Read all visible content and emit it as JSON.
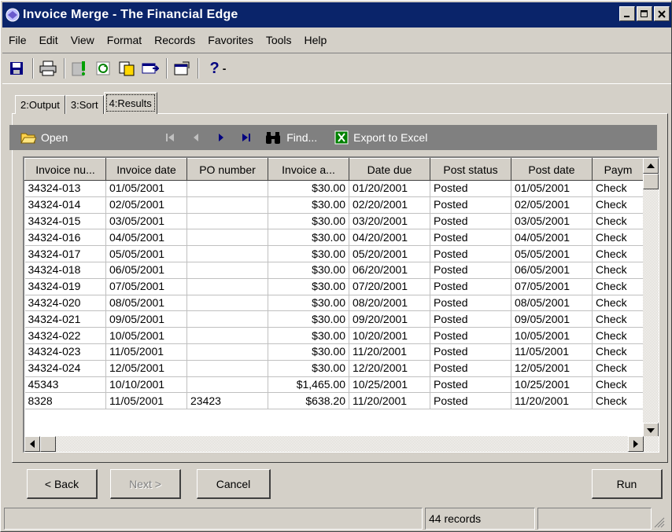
{
  "window": {
    "title": "Invoice Merge - The Financial Edge"
  },
  "menu": [
    {
      "label": "File"
    },
    {
      "label": "Edit"
    },
    {
      "label": "View"
    },
    {
      "label": "Format"
    },
    {
      "label": "Records"
    },
    {
      "label": "Favorites"
    },
    {
      "label": "Tools"
    },
    {
      "label": "Help"
    }
  ],
  "toolbar": {
    "icons": [
      "save-icon",
      "print-icon",
      "query-icon",
      "refresh-icon",
      "copy-icon",
      "export-icon",
      "properties-icon",
      "help-icon"
    ],
    "help_dropdown": "-"
  },
  "tabs": [
    {
      "label": "2:Output"
    },
    {
      "label": "3:Sort"
    },
    {
      "label": "4:Results"
    }
  ],
  "results_bar": {
    "open_label": "Open",
    "find_label": "Find...",
    "export_label": "Export to Excel"
  },
  "grid": {
    "columns": [
      "Invoice nu...",
      "Invoice date",
      "PO number",
      "Invoice a...",
      "Date due",
      "Post status",
      "Post date",
      "Paym"
    ],
    "rows": [
      [
        "34324-013",
        "01/05/2001",
        "",
        "$30.00",
        "01/20/2001",
        "Posted",
        "01/05/2001",
        "Check"
      ],
      [
        "34324-014",
        "02/05/2001",
        "",
        "$30.00",
        "02/20/2001",
        "Posted",
        "02/05/2001",
        "Check"
      ],
      [
        "34324-015",
        "03/05/2001",
        "",
        "$30.00",
        "03/20/2001",
        "Posted",
        "03/05/2001",
        "Check"
      ],
      [
        "34324-016",
        "04/05/2001",
        "",
        "$30.00",
        "04/20/2001",
        "Posted",
        "04/05/2001",
        "Check"
      ],
      [
        "34324-017",
        "05/05/2001",
        "",
        "$30.00",
        "05/20/2001",
        "Posted",
        "05/05/2001",
        "Check"
      ],
      [
        "34324-018",
        "06/05/2001",
        "",
        "$30.00",
        "06/20/2001",
        "Posted",
        "06/05/2001",
        "Check"
      ],
      [
        "34324-019",
        "07/05/2001",
        "",
        "$30.00",
        "07/20/2001",
        "Posted",
        "07/05/2001",
        "Check"
      ],
      [
        "34324-020",
        "08/05/2001",
        "",
        "$30.00",
        "08/20/2001",
        "Posted",
        "08/05/2001",
        "Check"
      ],
      [
        "34324-021",
        "09/05/2001",
        "",
        "$30.00",
        "09/20/2001",
        "Posted",
        "09/05/2001",
        "Check"
      ],
      [
        "34324-022",
        "10/05/2001",
        "",
        "$30.00",
        "10/20/2001",
        "Posted",
        "10/05/2001",
        "Check"
      ],
      [
        "34324-023",
        "11/05/2001",
        "",
        "$30.00",
        "11/20/2001",
        "Posted",
        "11/05/2001",
        "Check"
      ],
      [
        "34324-024",
        "12/05/2001",
        "",
        "$30.00",
        "12/20/2001",
        "Posted",
        "12/05/2001",
        "Check"
      ],
      [
        "45343",
        "10/10/2001",
        "",
        "$1,465.00",
        "10/25/2001",
        "Posted",
        "10/25/2001",
        "Check"
      ],
      [
        "8328",
        "11/05/2001",
        "23423",
        "$638.20",
        "11/20/2001",
        "Posted",
        "11/20/2001",
        "Check"
      ]
    ]
  },
  "buttons": {
    "back": "< Back",
    "next": "Next >",
    "cancel": "Cancel",
    "run": "Run"
  },
  "status": {
    "records": "44 records"
  },
  "colors": {
    "titlebar": "#0a246a",
    "face": "#d4d0c8",
    "results_bar": "#808080"
  }
}
